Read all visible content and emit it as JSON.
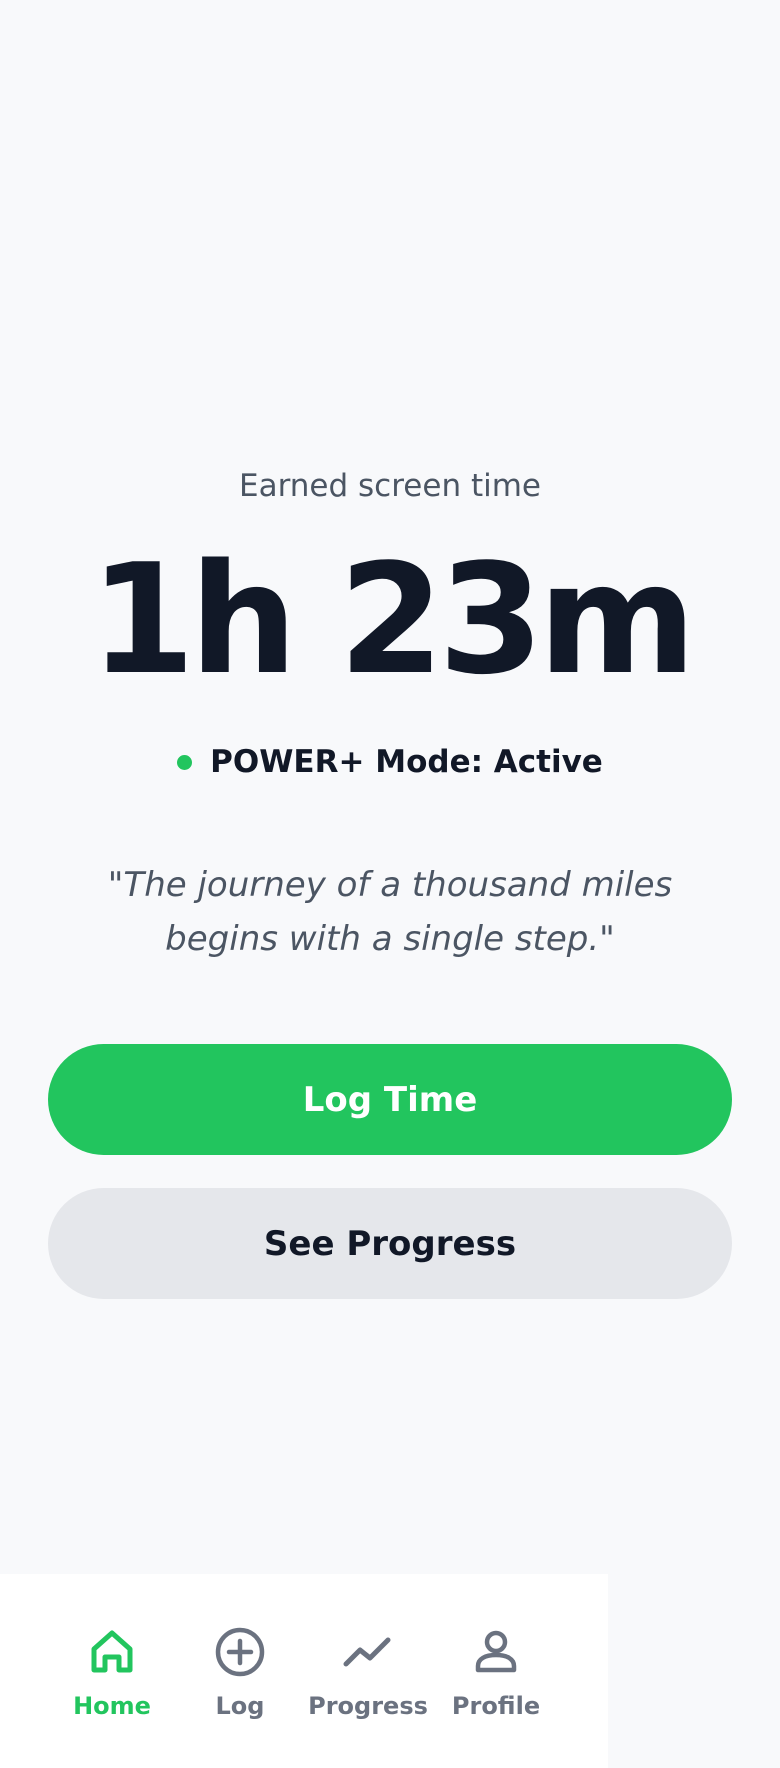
{
  "balance": {
    "label": "Earned screen time",
    "value": "1h 23m"
  },
  "mode": {
    "text": "POWER+ Mode: Active",
    "status_color": "#22c55e"
  },
  "quote": {
    "text": "\"The journey of a thousand miles begins with a single step.\""
  },
  "actions": {
    "primary_label": "Log Time",
    "secondary_label": "See Progress"
  },
  "nav": {
    "items": [
      {
        "label": "Home",
        "icon": "home-icon",
        "active": true
      },
      {
        "label": "Log",
        "icon": "plus-circle-icon",
        "active": false
      },
      {
        "label": "Progress",
        "icon": "trend-line-icon",
        "active": false
      },
      {
        "label": "Profile",
        "icon": "person-icon",
        "active": false
      }
    ]
  },
  "colors": {
    "accent": "#22c55e",
    "text_primary": "#111827",
    "text_secondary": "#4b5563",
    "background": "#f8f9fb"
  }
}
